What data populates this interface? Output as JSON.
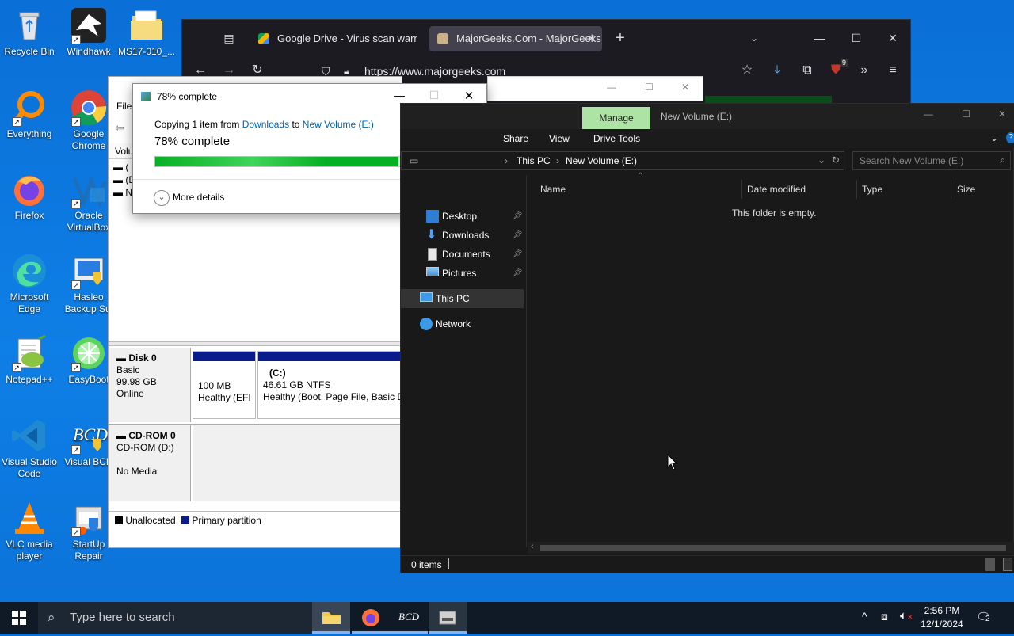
{
  "desktop": {
    "icons": [
      {
        "label": "Recycle Bin"
      },
      {
        "label": "Windhawk"
      },
      {
        "label": "MS17-010_..."
      },
      {
        "label": "Everything"
      },
      {
        "label": "Google Chrome"
      },
      {
        "label": "Firefox"
      },
      {
        "label": "Oracle VirtualBox"
      },
      {
        "label": "Microsoft Edge"
      },
      {
        "label": "Hasleo Backup Sui"
      },
      {
        "label": "Notepad++"
      },
      {
        "label": "EasyBoot"
      },
      {
        "label": "Visual Studio Code"
      },
      {
        "label": "Visual BCD"
      },
      {
        "label": "VLC media player"
      },
      {
        "label": "StartUp Repair"
      }
    ]
  },
  "browser": {
    "tabs": [
      {
        "label": "Google Drive - Virus scan warni"
      },
      {
        "label": "MajorGeeks.Com - MajorGeeks"
      }
    ],
    "url": "https://www.majorgeeks.com",
    "extension_badge": "9"
  },
  "copy_dialog": {
    "title": "78% complete",
    "copy_prefix": "Copying 1 item from",
    "source": "Downloads",
    "to": "to",
    "destination": "New Volume (E:)",
    "status": "78% complete",
    "progress": 0.78,
    "more_details": "More details"
  },
  "disk_mgmt": {
    "menu_file": "File",
    "col_volume": "Volu",
    "vol_rows": [
      "(",
      "(D",
      "N"
    ],
    "disk0": {
      "name": "Disk 0",
      "type": "Basic",
      "size": "99.98 GB",
      "status": "Online"
    },
    "part1": {
      "size": "100 MB",
      "status": "Healthy (EFI"
    },
    "part2": {
      "name": "(C:)",
      "size": "46.61 GB NTFS",
      "status": "Healthy (Boot, Page File, Basic Da"
    },
    "cdrom": {
      "name": "CD-ROM 0",
      "type": "CD-ROM (D:)",
      "media": "No Media"
    },
    "legend": [
      "Unallocated",
      "Primary partition"
    ]
  },
  "explorer": {
    "context_tab": "Manage",
    "title": "New Volume (E:)",
    "ribbon_tabs": [
      "Share",
      "View",
      "Drive Tools"
    ],
    "breadcrumb": [
      "This PC",
      "New Volume (E:)"
    ],
    "search_placeholder": "Search New Volume (E:)",
    "nav": [
      {
        "label": "Desktop"
      },
      {
        "label": "Downloads"
      },
      {
        "label": "Documents"
      },
      {
        "label": "Pictures"
      },
      {
        "label": "This PC"
      },
      {
        "label": "Network"
      }
    ],
    "columns": [
      "Name",
      "Date modified",
      "Type",
      "Size"
    ],
    "empty_text": "This folder is empty.",
    "status": "0 items"
  },
  "taskbar": {
    "search_placeholder": "Type here to search",
    "bcd_label": "BCD",
    "time": "2:56 PM",
    "date": "12/1/2024",
    "notification_count": "2"
  }
}
